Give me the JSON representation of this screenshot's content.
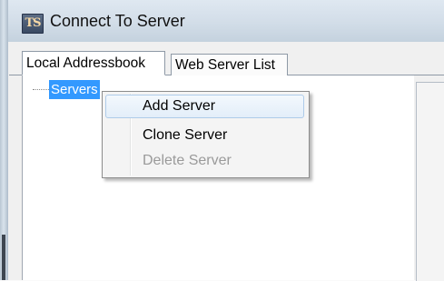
{
  "window": {
    "title": "Connect To Server",
    "icon_text": "TS",
    "icon_name": "app-icon"
  },
  "tabs": [
    {
      "label": "Local Addressbook",
      "selected": true
    },
    {
      "label": "Web Server List",
      "selected": false
    }
  ],
  "tree": {
    "root_label": "Servers",
    "selected": true
  },
  "context_menu": {
    "items": [
      {
        "label": "Add Server",
        "enabled": true,
        "highlighted": true
      },
      {
        "label": "Clone Server",
        "enabled": true,
        "highlighted": false
      },
      {
        "label": "Delete Server",
        "enabled": false,
        "highlighted": false
      }
    ]
  },
  "colors": {
    "selection": "#3399ff",
    "menu_highlight_border": "#aecbe9",
    "disabled_text": "#9a9a9a"
  }
}
